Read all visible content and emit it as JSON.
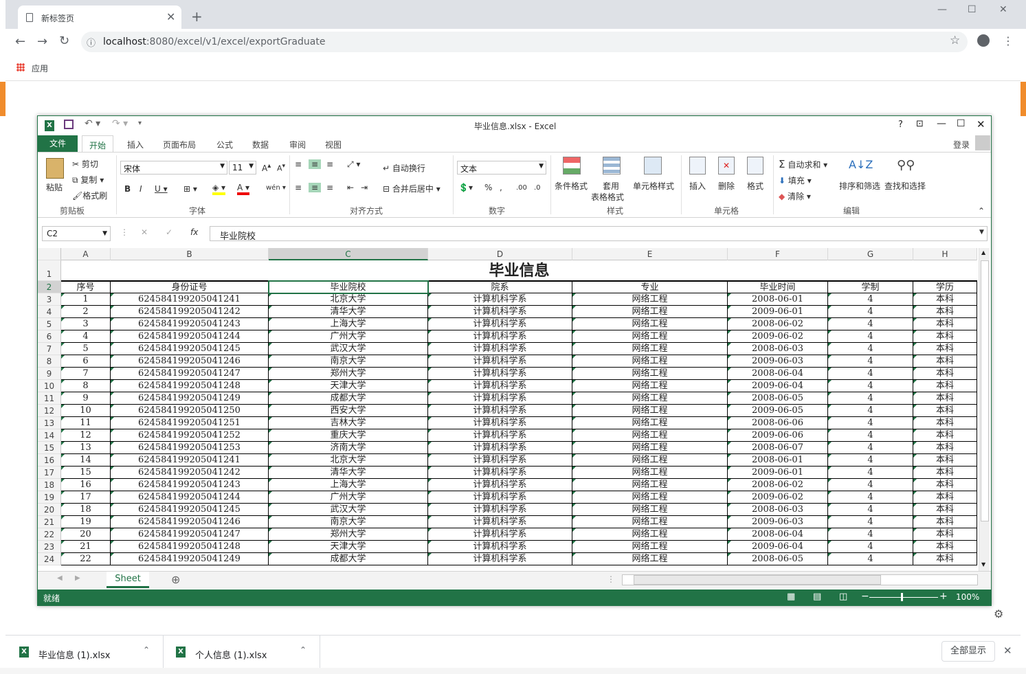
{
  "browser": {
    "tab_title": "新标签页",
    "url_host": "localhost",
    "url_rest": ":8080/excel/v1/excel/exportGraduate",
    "bookmark_apps": "应用"
  },
  "excel": {
    "title": "毕业信息.xlsx - Excel",
    "menu_tabs": [
      "文件",
      "开始",
      "插入",
      "页面布局",
      "公式",
      "数据",
      "审阅",
      "视图"
    ],
    "login": "登录",
    "clipboard": {
      "paste": "粘贴",
      "cut": "剪切",
      "copy": "复制",
      "format_painter": "格式刷",
      "group": "剪贴板"
    },
    "font": {
      "name": "宋体",
      "size": "11",
      "group": "字体"
    },
    "alignment": {
      "wrap": "自动换行",
      "merge": "合并后居中",
      "group": "对齐方式"
    },
    "number": {
      "format": "文本",
      "group": "数字"
    },
    "styles": {
      "conditional": "条件格式",
      "table1": "套用",
      "table2": "表格格式",
      "cell_styles": "单元格样式",
      "group": "样式"
    },
    "cells": {
      "insert": "插入",
      "delete": "删除",
      "format": "格式",
      "group": "单元格"
    },
    "editing": {
      "autosum": "自动求和",
      "fill": "填充",
      "clear": "清除",
      "sort": "排序和筛选",
      "find": "查找和选择",
      "group": "编辑"
    },
    "name_box": "C2",
    "formula": "毕业院校",
    "sheet_name": "Sheet",
    "status": "就绪",
    "zoom": "100%"
  },
  "sheet": {
    "columns": [
      "A",
      "B",
      "C",
      "D",
      "E",
      "F",
      "G",
      "H"
    ],
    "title": "毕业信息",
    "headers": [
      "序号",
      "身份证号",
      "毕业院校",
      "院系",
      "专业",
      "毕业时间",
      "学制",
      "学历"
    ],
    "rows": [
      [
        "1",
        "624584199205041241",
        "北京大学",
        "计算机科学系",
        "网络工程",
        "2008-06-01",
        "4",
        "本科"
      ],
      [
        "2",
        "624584199205041242",
        "清华大学",
        "计算机科学系",
        "网络工程",
        "2009-06-01",
        "4",
        "本科"
      ],
      [
        "3",
        "624584199205041243",
        "上海大学",
        "计算机科学系",
        "网络工程",
        "2008-06-02",
        "4",
        "本科"
      ],
      [
        "4",
        "624584199205041244",
        "广州大学",
        "计算机科学系",
        "网络工程",
        "2009-06-02",
        "4",
        "本科"
      ],
      [
        "5",
        "624584199205041245",
        "武汉大学",
        "计算机科学系",
        "网络工程",
        "2008-06-03",
        "4",
        "本科"
      ],
      [
        "6",
        "624584199205041246",
        "南京大学",
        "计算机科学系",
        "网络工程",
        "2009-06-03",
        "4",
        "本科"
      ],
      [
        "7",
        "624584199205041247",
        "郑州大学",
        "计算机科学系",
        "网络工程",
        "2008-06-04",
        "4",
        "本科"
      ],
      [
        "8",
        "624584199205041248",
        "天津大学",
        "计算机科学系",
        "网络工程",
        "2009-06-04",
        "4",
        "本科"
      ],
      [
        "9",
        "624584199205041249",
        "成都大学",
        "计算机科学系",
        "网络工程",
        "2008-06-05",
        "4",
        "本科"
      ],
      [
        "10",
        "624584199205041250",
        "西安大学",
        "计算机科学系",
        "网络工程",
        "2009-06-05",
        "4",
        "本科"
      ],
      [
        "11",
        "624584199205041251",
        "吉林大学",
        "计算机科学系",
        "网络工程",
        "2008-06-06",
        "4",
        "本科"
      ],
      [
        "12",
        "624584199205041252",
        "重庆大学",
        "计算机科学系",
        "网络工程",
        "2009-06-06",
        "4",
        "本科"
      ],
      [
        "13",
        "624584199205041253",
        "济南大学",
        "计算机科学系",
        "网络工程",
        "2008-06-07",
        "4",
        "本科"
      ],
      [
        "14",
        "624584199205041241",
        "北京大学",
        "计算机科学系",
        "网络工程",
        "2008-06-01",
        "4",
        "本科"
      ],
      [
        "15",
        "624584199205041242",
        "清华大学",
        "计算机科学系",
        "网络工程",
        "2009-06-01",
        "4",
        "本科"
      ],
      [
        "16",
        "624584199205041243",
        "上海大学",
        "计算机科学系",
        "网络工程",
        "2008-06-02",
        "4",
        "本科"
      ],
      [
        "17",
        "624584199205041244",
        "广州大学",
        "计算机科学系",
        "网络工程",
        "2009-06-02",
        "4",
        "本科"
      ],
      [
        "18",
        "624584199205041245",
        "武汉大学",
        "计算机科学系",
        "网络工程",
        "2008-06-03",
        "4",
        "本科"
      ],
      [
        "19",
        "624584199205041246",
        "南京大学",
        "计算机科学系",
        "网络工程",
        "2009-06-03",
        "4",
        "本科"
      ],
      [
        "20",
        "624584199205041247",
        "郑州大学",
        "计算机科学系",
        "网络工程",
        "2008-06-04",
        "4",
        "本科"
      ],
      [
        "21",
        "624584199205041248",
        "天津大学",
        "计算机科学系",
        "网络工程",
        "2009-06-04",
        "4",
        "本科"
      ],
      [
        "22",
        "624584199205041249",
        "成都大学",
        "计算机科学系",
        "网络工程",
        "2008-06-05",
        "4",
        "本科"
      ]
    ]
  },
  "downloads": [
    {
      "name": "毕业信息 (1).xlsx"
    },
    {
      "name": "个人信息 (1).xlsx"
    }
  ],
  "show_all": "全部显示",
  "colors": {
    "excel_green": "#217346"
  }
}
